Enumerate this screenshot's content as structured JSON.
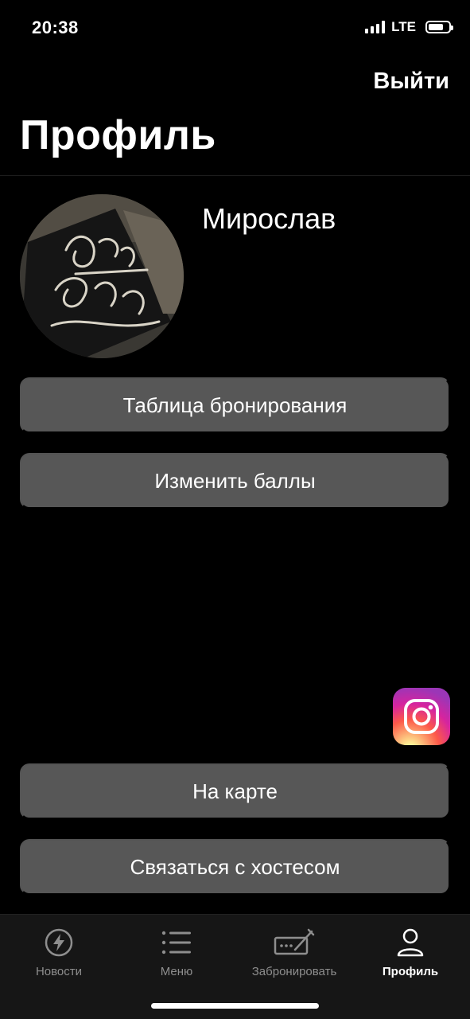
{
  "status": {
    "time": "20:38",
    "network": "LTE",
    "battery_level": 0.75
  },
  "header": {
    "logout_label": "Выйти",
    "title": "Профиль"
  },
  "profile": {
    "name": "Мирослав"
  },
  "actions": {
    "booking_table": "Таблица бронирования",
    "change_points": "Изменить баллы",
    "on_map": "На карте",
    "contact_host": "Связаться с хостесом"
  },
  "tabs": [
    {
      "label": "Новости",
      "icon": "lightning-icon",
      "active": false
    },
    {
      "label": "Меню",
      "icon": "list-icon",
      "active": false
    },
    {
      "label": "Забронировать",
      "icon": "booking-icon",
      "active": false
    },
    {
      "label": "Профиль",
      "icon": "person-icon",
      "active": true
    }
  ],
  "colors": {
    "background": "#000000",
    "button": "#575757",
    "tab_bar": "#161616",
    "tab_inactive": "#8e8e8e",
    "tab_active": "#ffffff"
  }
}
